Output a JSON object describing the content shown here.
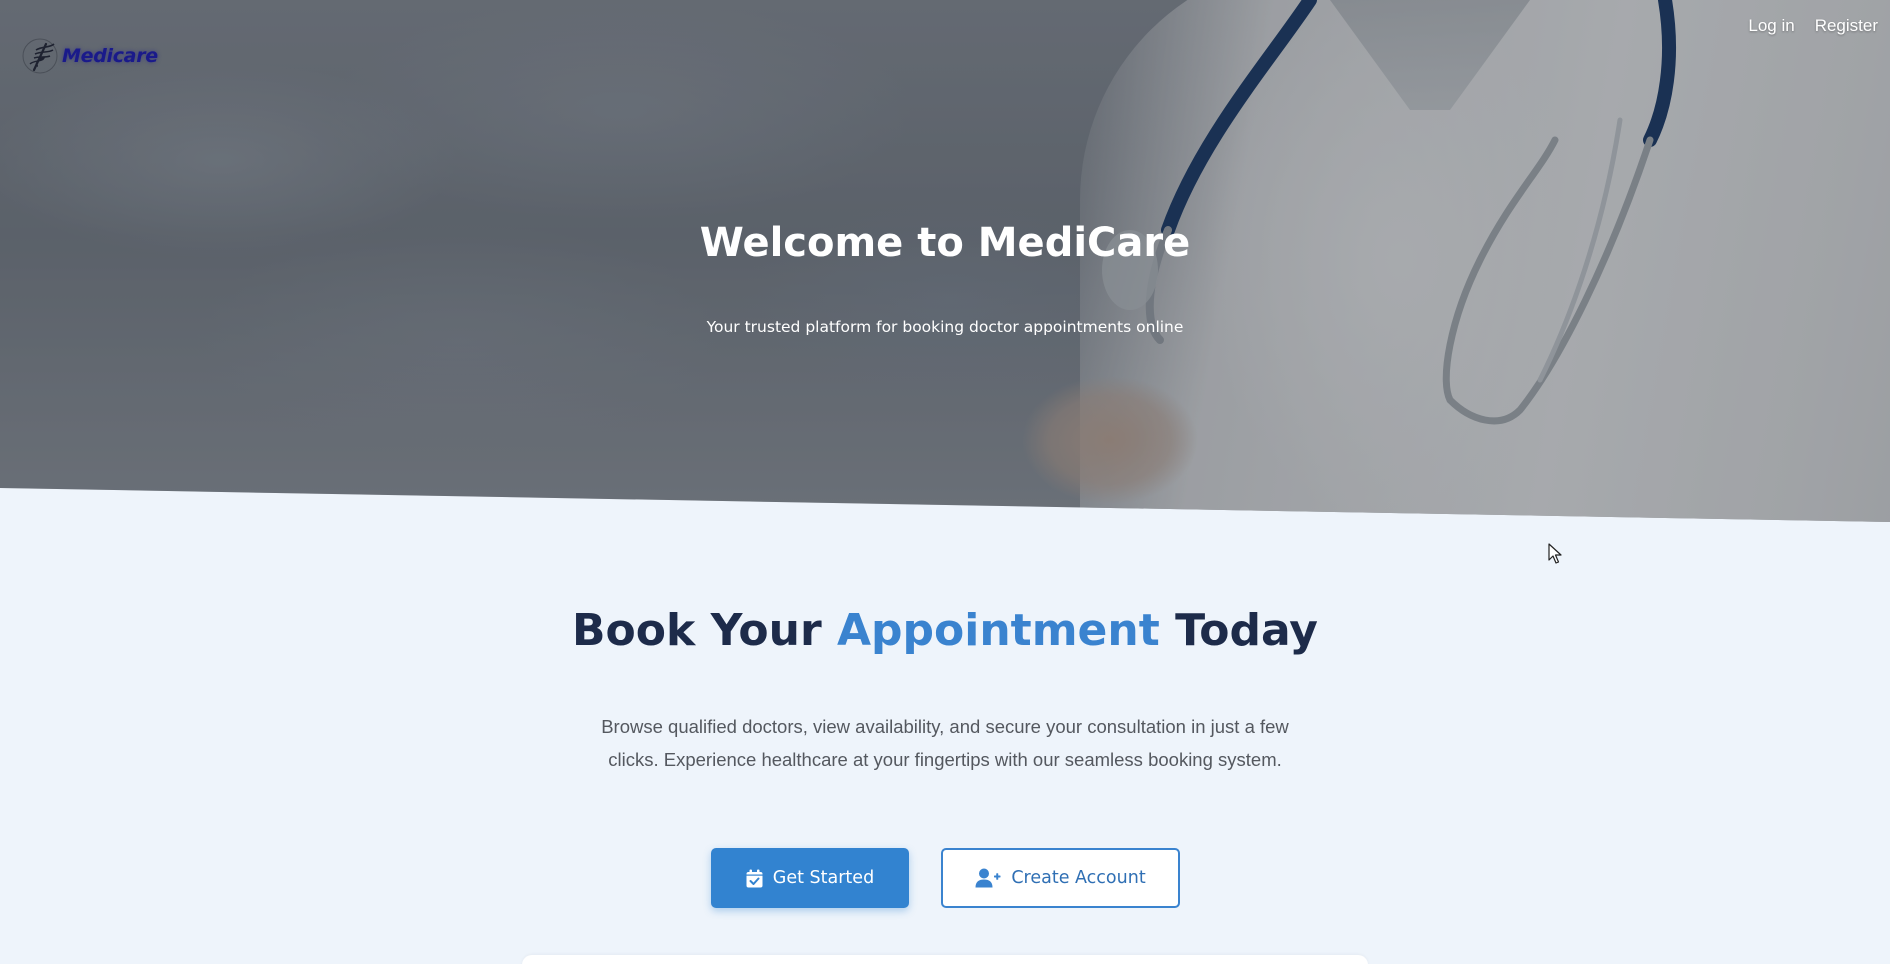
{
  "header": {
    "logo_text": "Medicare",
    "nav": [
      {
        "label": "Log in"
      },
      {
        "label": "Register"
      }
    ]
  },
  "hero": {
    "title": "Welcome to MediCare",
    "subtitle": "Your trusted platform for booking doctor appointments online"
  },
  "main": {
    "title_part1": "Book Your ",
    "title_accent": "Appointment",
    "title_part2": " Today",
    "description": "Browse qualified doctors, view availability, and secure your consultation in just a few clicks. Experience healthcare at your fingertips with our seamless booking system.",
    "primary_button": "Get Started",
    "secondary_button": "Create Account"
  },
  "colors": {
    "accent": "#3a83cf",
    "primary_button": "#3283d0",
    "heading": "#1d2b4a",
    "page_background": "#eef4fb"
  },
  "icons": {
    "logo": "caduceus-icon",
    "primary_button": "calendar-check-icon",
    "secondary_button": "user-plus-icon"
  }
}
